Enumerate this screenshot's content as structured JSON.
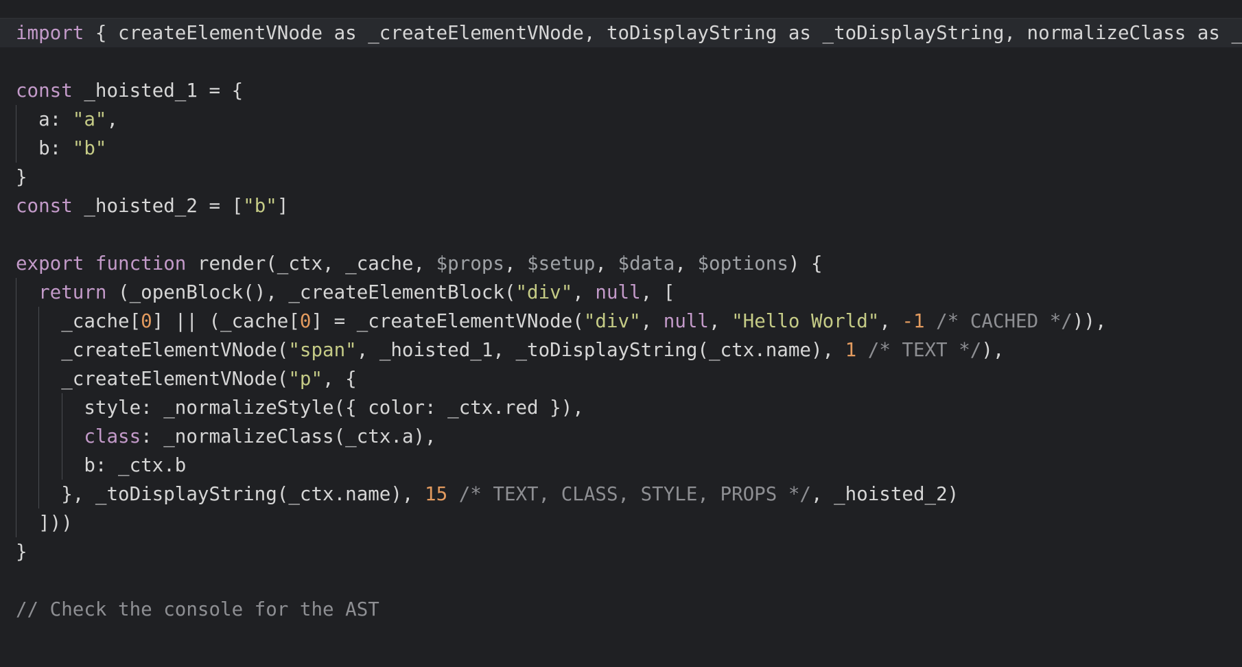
{
  "editor": {
    "theme_colors": {
      "background": "#1f2023",
      "keyword": "#c39ac9",
      "string": "#c5cb86",
      "number": "#e39b5f",
      "comment": "#8e8f93",
      "plain": "#d6d6d6"
    },
    "lines": [
      {
        "active": true,
        "indent": 0,
        "tokens": [
          {
            "t": "import",
            "c": "kw"
          },
          {
            "t": " { createElementVNode as _createElementVNode, toDisplayString as _toDisplayString, normalizeClass as _normalizeClass, normalizeStyle as _normalizeStyle, openBlock as _openBlock, createElementBlock as _createElementBlock } from \"vue\"",
            "c": "pl"
          }
        ]
      },
      {
        "indent": 0,
        "tokens": []
      },
      {
        "indent": 0,
        "tokens": [
          {
            "t": "const",
            "c": "kw"
          },
          {
            "t": " _hoisted_1 = {",
            "c": "pl"
          }
        ]
      },
      {
        "indent": 1,
        "tokens": [
          {
            "t": "  a: ",
            "c": "pl"
          },
          {
            "t": "\"a\"",
            "c": "str"
          },
          {
            "t": ",",
            "c": "pl"
          }
        ]
      },
      {
        "indent": 1,
        "tokens": [
          {
            "t": "  b: ",
            "c": "pl"
          },
          {
            "t": "\"b\"",
            "c": "str"
          }
        ]
      },
      {
        "indent": 0,
        "tokens": [
          {
            "t": "}",
            "c": "pl"
          }
        ]
      },
      {
        "indent": 0,
        "tokens": [
          {
            "t": "const",
            "c": "kw"
          },
          {
            "t": " _hoisted_2 = [",
            "c": "pl"
          },
          {
            "t": "\"b\"",
            "c": "str"
          },
          {
            "t": "]",
            "c": "pl"
          }
        ]
      },
      {
        "indent": 0,
        "tokens": []
      },
      {
        "indent": 0,
        "tokens": [
          {
            "t": "export",
            "c": "kw"
          },
          {
            "t": " ",
            "c": "pl"
          },
          {
            "t": "function",
            "c": "kw"
          },
          {
            "t": " render(_ctx, _cache, ",
            "c": "pl"
          },
          {
            "t": "$props",
            "c": "var"
          },
          {
            "t": ", ",
            "c": "pl"
          },
          {
            "t": "$setup",
            "c": "var"
          },
          {
            "t": ", ",
            "c": "pl"
          },
          {
            "t": "$data",
            "c": "var"
          },
          {
            "t": ", ",
            "c": "pl"
          },
          {
            "t": "$options",
            "c": "var"
          },
          {
            "t": ") {",
            "c": "pl"
          }
        ]
      },
      {
        "indent": 1,
        "tokens": [
          {
            "t": "  ",
            "c": "pl"
          },
          {
            "t": "return",
            "c": "kw"
          },
          {
            "t": " (_openBlock(), _createElementBlock(",
            "c": "pl"
          },
          {
            "t": "\"div\"",
            "c": "str"
          },
          {
            "t": ", ",
            "c": "pl"
          },
          {
            "t": "null",
            "c": "kw"
          },
          {
            "t": ", [",
            "c": "pl"
          }
        ]
      },
      {
        "indent": 2,
        "tokens": [
          {
            "t": "    _cache[",
            "c": "pl"
          },
          {
            "t": "0",
            "c": "num"
          },
          {
            "t": "] || (_cache[",
            "c": "pl"
          },
          {
            "t": "0",
            "c": "num"
          },
          {
            "t": "] = _createElementVNode(",
            "c": "pl"
          },
          {
            "t": "\"div\"",
            "c": "str"
          },
          {
            "t": ", ",
            "c": "pl"
          },
          {
            "t": "null",
            "c": "kw"
          },
          {
            "t": ", ",
            "c": "pl"
          },
          {
            "t": "\"Hello World\"",
            "c": "str"
          },
          {
            "t": ", ",
            "c": "pl"
          },
          {
            "t": "-1",
            "c": "num"
          },
          {
            "t": " /* CACHED */",
            "c": "cmt"
          },
          {
            "t": ")),",
            "c": "pl"
          }
        ]
      },
      {
        "indent": 2,
        "tokens": [
          {
            "t": "    _createElementVNode(",
            "c": "pl"
          },
          {
            "t": "\"span\"",
            "c": "str"
          },
          {
            "t": ", _hoisted_1, _toDisplayString(_ctx.name), ",
            "c": "pl"
          },
          {
            "t": "1",
            "c": "num"
          },
          {
            "t": " /* TEXT */",
            "c": "cmt"
          },
          {
            "t": "),",
            "c": "pl"
          }
        ]
      },
      {
        "indent": 2,
        "tokens": [
          {
            "t": "    _createElementVNode(",
            "c": "pl"
          },
          {
            "t": "\"p\"",
            "c": "str"
          },
          {
            "t": ", {",
            "c": "pl"
          }
        ]
      },
      {
        "indent": 3,
        "tokens": [
          {
            "t": "      style: _normalizeStyle({ color: _ctx.red }),",
            "c": "pl"
          }
        ]
      },
      {
        "indent": 3,
        "tokens": [
          {
            "t": "      ",
            "c": "pl"
          },
          {
            "t": "class",
            "c": "kw"
          },
          {
            "t": ": _normalizeClass(_ctx.a),",
            "c": "pl"
          }
        ]
      },
      {
        "indent": 3,
        "tokens": [
          {
            "t": "      b: _ctx.b",
            "c": "pl"
          }
        ]
      },
      {
        "indent": 2,
        "tokens": [
          {
            "t": "    }, _toDisplayString(_ctx.name), ",
            "c": "pl"
          },
          {
            "t": "15",
            "c": "num"
          },
          {
            "t": " /* TEXT, CLASS, STYLE, PROPS */",
            "c": "cmt"
          },
          {
            "t": ", _hoisted_2)",
            "c": "pl"
          }
        ]
      },
      {
        "indent": 1,
        "tokens": [
          {
            "t": "  ]))",
            "c": "pl"
          }
        ]
      },
      {
        "indent": 0,
        "tokens": [
          {
            "t": "}",
            "c": "pl"
          }
        ]
      },
      {
        "indent": 0,
        "tokens": []
      },
      {
        "indent": 0,
        "tokens": [
          {
            "t": "// Check the console for the AST",
            "c": "cmt"
          }
        ]
      }
    ]
  }
}
